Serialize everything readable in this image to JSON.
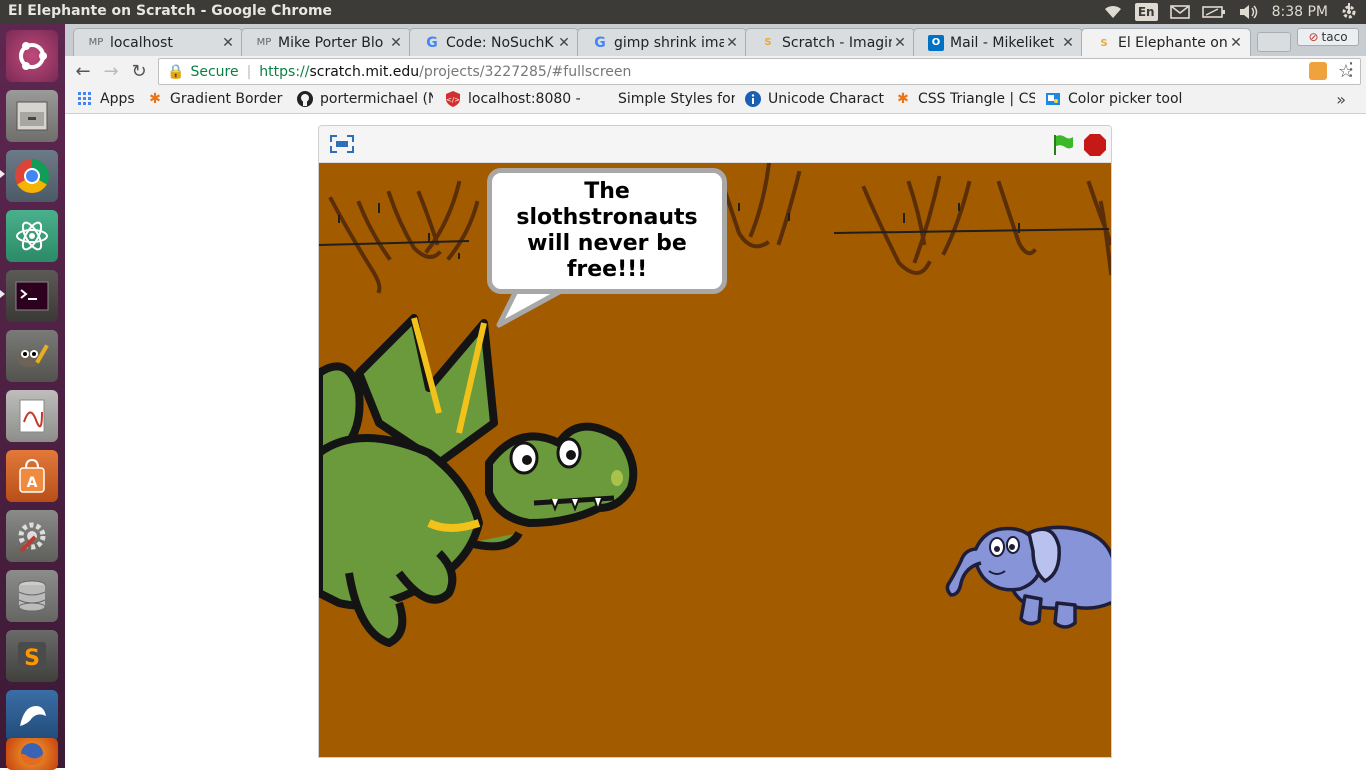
{
  "system": {
    "window_title": "El Elephante on Scratch - Google Chrome",
    "language": "En",
    "clock": "8:38 PM"
  },
  "launcher": {
    "items": [
      {
        "name": "ubuntu-dash-icon"
      },
      {
        "name": "files-icon"
      },
      {
        "name": "chrome-icon"
      },
      {
        "name": "atom-icon"
      },
      {
        "name": "terminal-icon"
      },
      {
        "name": "gimp-icon"
      },
      {
        "name": "pdf-reader-icon"
      },
      {
        "name": "software-center-icon"
      },
      {
        "name": "system-settings-icon"
      },
      {
        "name": "database-icon"
      },
      {
        "name": "sublime-text-icon"
      },
      {
        "name": "mysql-workbench-icon"
      },
      {
        "name": "firefox-icon"
      }
    ]
  },
  "browser": {
    "tabs": [
      {
        "fav": "MP",
        "title": "localhost"
      },
      {
        "fav": "MP",
        "title": "Mike Porter Blo"
      },
      {
        "fav": "G",
        "title": "Code: NoSuchK"
      },
      {
        "fav": "G",
        "title": "gimp shrink ima"
      },
      {
        "fav": "S",
        "title": "Scratch - Imagin"
      },
      {
        "fav": "O",
        "title": "Mail - Mikeliket"
      },
      {
        "fav": "S",
        "title": "El Elephante on"
      }
    ],
    "profile": "taco",
    "secure_label": "Secure",
    "url_scheme": "https://",
    "url_host": "scratch.mit.edu",
    "url_path": "/projects/3227285/#fullscreen",
    "bookmarks": [
      {
        "icon": "apps-icon",
        "label": "Apps"
      },
      {
        "icon": "asterisk-icon",
        "label": "Gradient Border"
      },
      {
        "icon": "github-icon",
        "label": "portermichael (N"
      },
      {
        "icon": "shield-icon",
        "label": "localhost:8080 - ("
      },
      {
        "icon": "blank-icon",
        "label": "Simple Styles for"
      },
      {
        "icon": "info-icon",
        "label": "Unicode Charact"
      },
      {
        "icon": "asterisk-icon",
        "label": "CSS Triangle | CS"
      },
      {
        "icon": "color-picker-icon",
        "label": "Color picker tool"
      }
    ]
  },
  "scratch": {
    "speech": "The slothstronauts will never be free!!!",
    "colors": {
      "stage": "#a35b00",
      "dragon": "#6b9a3c",
      "elephant": "#8795d8",
      "flag": "#3bb928",
      "stop": "#c71818"
    }
  }
}
